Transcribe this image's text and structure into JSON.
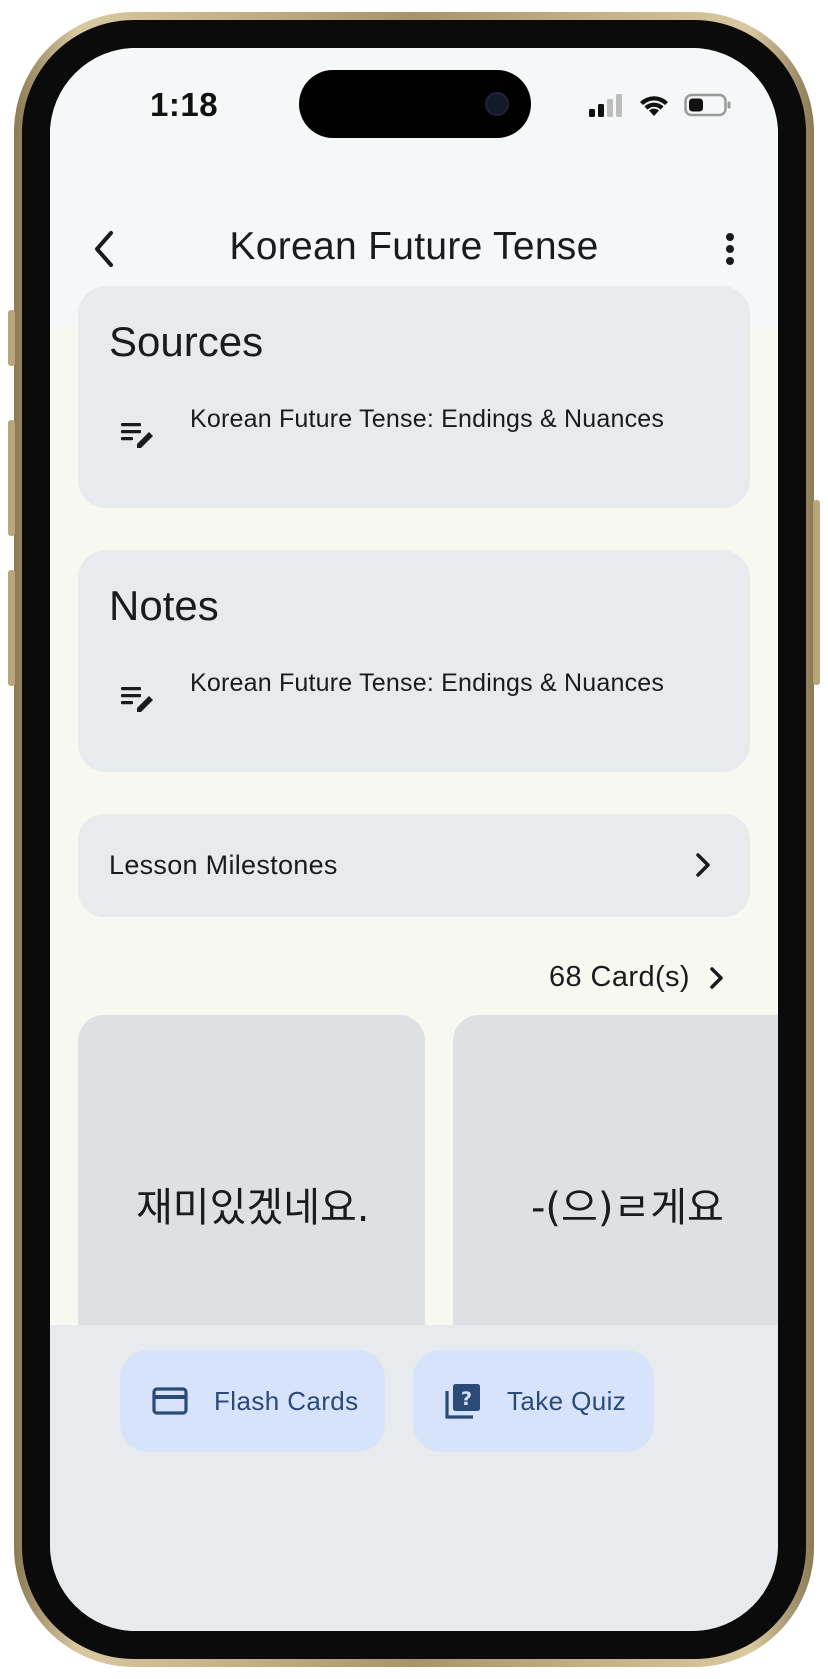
{
  "status_bar": {
    "time": "1:18"
  },
  "app_bar": {
    "title": "Korean Future Tense",
    "back_icon": "arrow-back-icon",
    "more_icon": "more-vert-icon"
  },
  "sources": {
    "title": "Sources",
    "items": [
      {
        "icon": "edit-note-icon",
        "label": "Korean Future Tense: Endings & Nuances"
      }
    ]
  },
  "notes": {
    "title": "Notes",
    "items": [
      {
        "icon": "edit-note-icon",
        "label": "Korean Future Tense: Endings & Nuances"
      }
    ]
  },
  "milestones": {
    "label": "Lesson Milestones"
  },
  "cards": {
    "count_label": "68 Card(s)",
    "items": [
      {
        "front": "재미있겠네요."
      },
      {
        "front": "-(으)ㄹ게요"
      }
    ]
  },
  "bottom_actions": {
    "flash_cards_label": "Flash Cards",
    "take_quiz_label": "Take Quiz"
  },
  "colors": {
    "screen_bg": "#f7f8ef",
    "card_bg": "#e7ebee",
    "flash_card_bg": "#dde1e4",
    "action_button_bg": "#d7e3fb",
    "action_text": "#2a4a78"
  }
}
